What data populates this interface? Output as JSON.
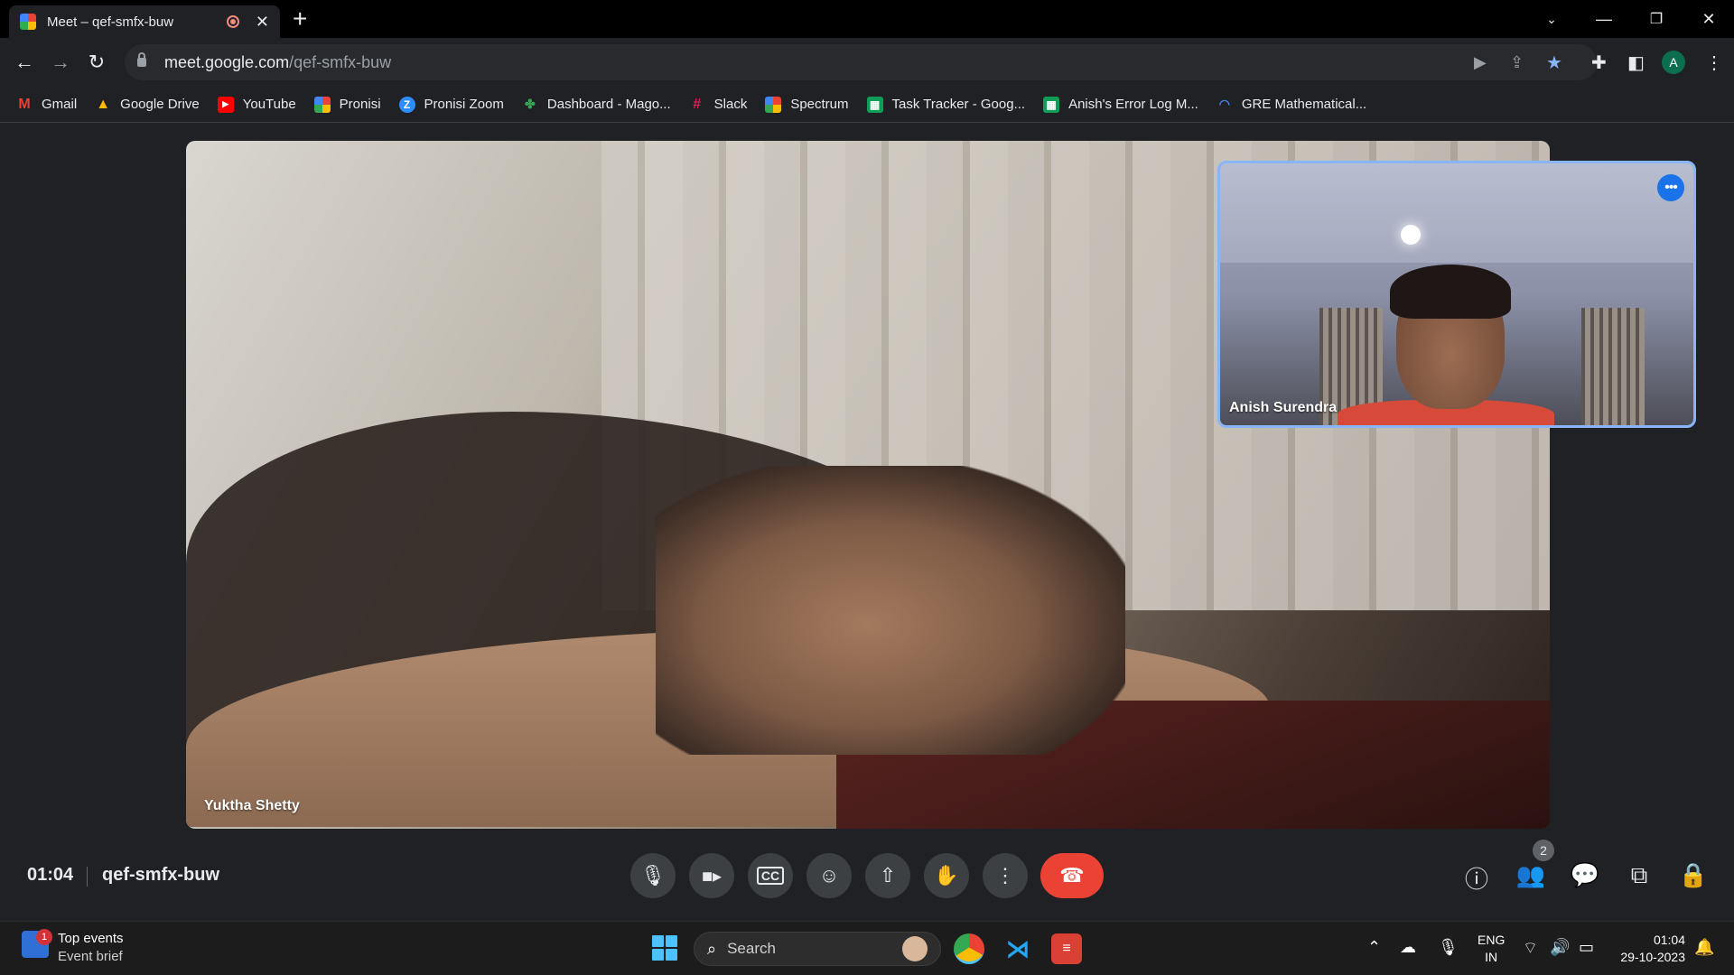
{
  "browser": {
    "tab_title": "Meet – qef-smfx-buw",
    "url_host": "meet.google.com",
    "url_path": "/qef-smfx-buw",
    "profile_initial": "A"
  },
  "bookmarks": [
    {
      "label": "Gmail",
      "icon": "gmail-icon",
      "color": "#ea4335"
    },
    {
      "label": "Google Drive",
      "icon": "drive-icon",
      "color": "#fbbc04"
    },
    {
      "label": "YouTube",
      "icon": "youtube-icon",
      "color": "#ff0000"
    },
    {
      "label": "Pronisi",
      "icon": "meet-icon",
      "color": "#00897b"
    },
    {
      "label": "Pronisi Zoom",
      "icon": "zoom-icon",
      "color": "#2d8cff"
    },
    {
      "label": "Dashboard - Mago...",
      "icon": "dashboard-icon",
      "color": "#34a853"
    },
    {
      "label": "Slack",
      "icon": "slack-icon",
      "color": "#e01e5a"
    },
    {
      "label": "Spectrum",
      "icon": "meet-icon",
      "color": "#00897b"
    },
    {
      "label": "Task Tracker - Goog...",
      "icon": "sheets-icon",
      "color": "#0f9d58"
    },
    {
      "label": "Anish's Error Log M...",
      "icon": "sheets-icon",
      "color": "#0f9d58"
    },
    {
      "label": "GRE Mathematical...",
      "icon": "loading-icon",
      "color": "#4285f4"
    }
  ],
  "meeting": {
    "main_participant": "Yuktha Shetty",
    "self_participant": "Anish Surendra",
    "time": "01:04",
    "code": "qef-smfx-buw",
    "participant_count": "2"
  },
  "taskbar": {
    "widget_badge": "1",
    "widget_title": "Top events",
    "widget_subtitle": "Event brief",
    "search_placeholder": "Search",
    "lang_top": "ENG",
    "lang_bottom": "IN",
    "clock_time": "01:04",
    "clock_date": "29-10-2023"
  },
  "colors": {
    "accent": "#8ab4f8",
    "end_call": "#ea4335",
    "background": "#202124"
  }
}
